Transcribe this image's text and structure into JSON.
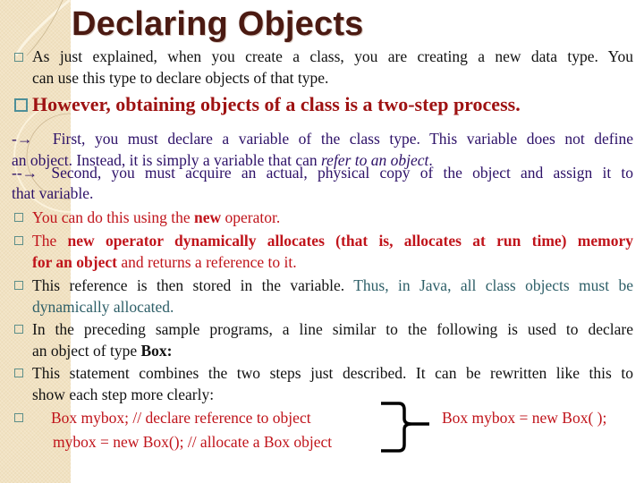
{
  "slide": {
    "title": "Declaring Objects",
    "intro": {
      "bullet_icon": "hollow-square-bullet",
      "line1": "As just explained, when you create a class, you are creating a new data type. You",
      "line2": "can use this type to declare objects of that type."
    },
    "heading": {
      "bullet_icon": "hollow-square-bullet",
      "text": "However, obtaining objects of a class is a two-step process."
    },
    "step1": {
      "arrow": "-→",
      "text_a": "First, you must declare a variable of the class type. This variable does not define",
      "text_b": "an object. Instead, it is simply a variable that can ",
      "text_b_italic": "refer to an object",
      "text_b_end": "."
    },
    "step2": {
      "arrow": "--→",
      "text_a": "Second, you must acquire an actual, physical copy of the object and assign it to",
      "text_b": "that variable."
    },
    "bullets": [
      {
        "icon": "hollow-square-bullet",
        "part1": "You can do this using the ",
        "bold": "new",
        "part2": " operator."
      },
      {
        "icon": "hollow-square-bullet",
        "part1": "The ",
        "bold_line1": "new operator dynamically allocates (that is, allocates at run time) memory",
        "bold_line2": "for an object",
        "part2": " and returns a reference to it."
      },
      {
        "icon": "hollow-square-bullet",
        "black": "This reference is then stored in the variable.",
        "teal_line1": " Thus, in Java, all class objects must be",
        "teal_line2": "dynamically allocated."
      },
      {
        "icon": "hollow-square-bullet",
        "line1": "In the preceding sample programs, a line similar to the following is used to declare",
        "line2": "an object of type ",
        "bold": "Box:"
      },
      {
        "icon": "hollow-square-bullet",
        "line1": "This statement combines the two steps just described. It can be rewritten like this to",
        "line2": "show each step more clearly:"
      }
    ],
    "code": {
      "icon": "hollow-square-bullet",
      "line1": "Box mybox; // declare reference to object",
      "line2": "mybox = new Box(); // allocate a Box object",
      "combined": "Box mybox = new Box( );",
      "connector_icon": "curly-brace-right"
    },
    "colors": {
      "title": "#4b1a12",
      "heading": "#9e1212",
      "red": "#c0141b",
      "purple": "#2d1168",
      "teal": "#2e5f68",
      "bullet": "#5d8f8a"
    }
  }
}
